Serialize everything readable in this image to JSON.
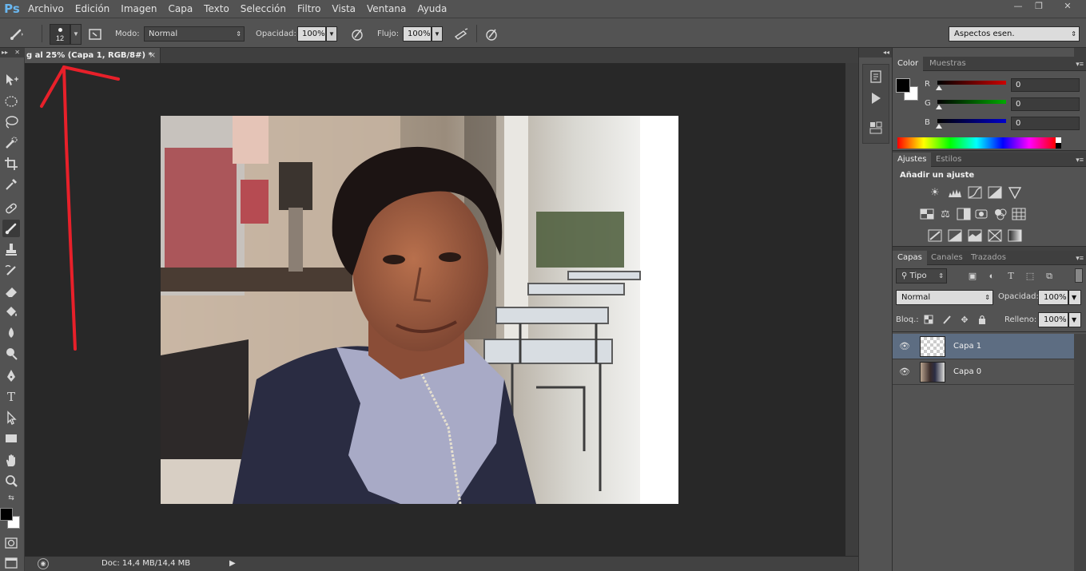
{
  "app": {
    "logo": "Ps"
  },
  "menu": [
    "Archivo",
    "Edición",
    "Imagen",
    "Capa",
    "Texto",
    "Selección",
    "Filtro",
    "Vista",
    "Ventana",
    "Ayuda"
  ],
  "window_controls": {
    "minimize": "—",
    "restore": "❐",
    "close": "✕"
  },
  "options": {
    "brush_size": "12",
    "mode_label": "Modo:",
    "mode_value": "Normal",
    "opacity_label": "Opacidad:",
    "opacity_value": "100%",
    "flow_label": "Flujo:",
    "flow_value": "100%"
  },
  "workspace": {
    "value": "Aspectos esen."
  },
  "document": {
    "tab_title": "g al 25% (Capa 1, RGB/8#) *",
    "tab_close": "×",
    "status": "Doc: 14,4 MB/14,4 MB"
  },
  "color_panel": {
    "tabs": [
      "Color",
      "Muestras"
    ],
    "channels": [
      {
        "label": "R",
        "value": "0"
      },
      {
        "label": "G",
        "value": "0"
      },
      {
        "label": "B",
        "value": "0"
      }
    ],
    "accent_colors": {
      "red": "#cc0000",
      "green": "#00aa00",
      "blue": "#0000cc"
    }
  },
  "adjustments_panel": {
    "tabs": [
      "Ajustes",
      "Estilos"
    ],
    "title": "Añadir un ajuste"
  },
  "layers_panel": {
    "tabs": [
      "Capas",
      "Canales",
      "Trazados"
    ],
    "filter_value": "Tipo",
    "blend_value": "Normal",
    "opacity_label": "Opacidad:",
    "opacity_value": "100%",
    "lock_label": "Bloq.:",
    "fill_label": "Relleno:",
    "fill_value": "100%",
    "layers": [
      {
        "name": "Capa 1",
        "selected": true
      },
      {
        "name": "Capa 0",
        "selected": false
      }
    ]
  },
  "annotation": {
    "color": "#e8202a"
  }
}
